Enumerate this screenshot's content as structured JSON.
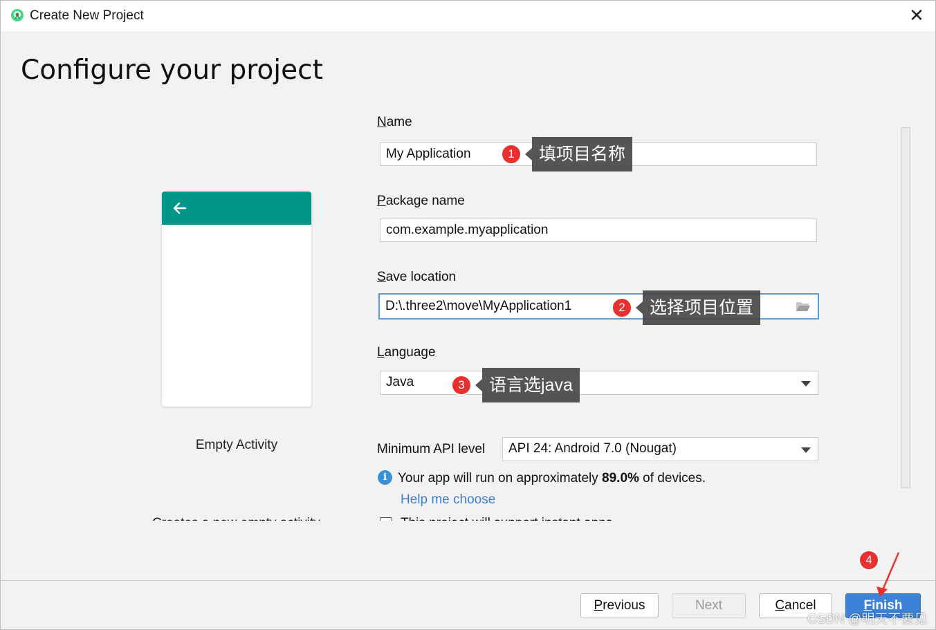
{
  "window": {
    "title": "Create New Project",
    "close_label": "✕"
  },
  "heading": "Configure your project",
  "template": {
    "name": "Empty Activity",
    "description": "Creates a new empty activity"
  },
  "form": {
    "name": {
      "label_accel": "N",
      "label_rest": "ame",
      "value": "My Application"
    },
    "package": {
      "label_accel": "P",
      "label_rest": "ackage name",
      "value": "com.example.myapplication"
    },
    "save_location": {
      "label_accel": "S",
      "label_rest": "ave location",
      "value": "D:\\.three2\\move\\MyApplication1"
    },
    "language": {
      "label_accel": "L",
      "label_rest": "anguage",
      "value": "Java"
    },
    "min_api": {
      "label": "Minimum API level",
      "value": "API 24: Android 7.0 (Nougat)"
    },
    "info": {
      "prefix": "Your app will run on approximately ",
      "percent": "89.0%",
      "suffix": " of devices."
    },
    "help_link": "Help me choose",
    "instant_app": {
      "label": "This project will support instant apps",
      "checked": false
    }
  },
  "buttons": {
    "previous": {
      "accel": "P",
      "rest": "revious"
    },
    "next": "Next",
    "cancel": {
      "accel": "C",
      "rest": "ancel"
    },
    "finish": {
      "accel": "F",
      "rest": "inish"
    }
  },
  "annotations": [
    {
      "number": "1",
      "text": "填项目名称"
    },
    {
      "number": "2",
      "text": "选择项目位置"
    },
    {
      "number": "3",
      "text": "语言选java"
    },
    {
      "number": "4",
      "text": ""
    }
  ],
  "watermark": "CSDN @明天不要见",
  "colors": {
    "toolbar_teal": "#009688",
    "primary_button": "#3b82d8",
    "link_blue": "#3f7ecb",
    "badge_red": "#e8302f"
  }
}
